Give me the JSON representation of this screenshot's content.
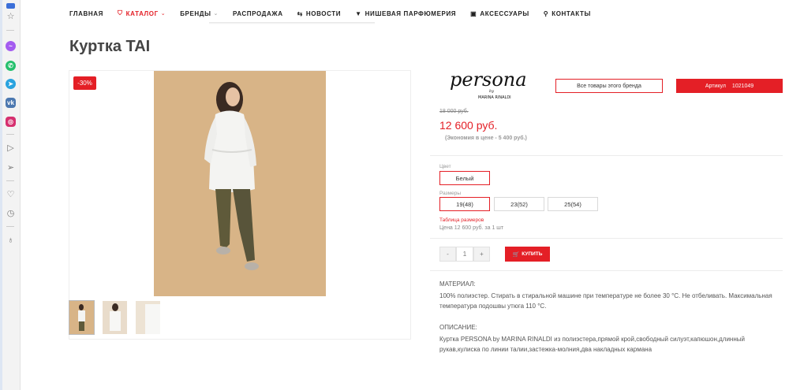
{
  "nav": {
    "items": [
      {
        "label": "ГЛАВНАЯ",
        "icon": "",
        "caret": false
      },
      {
        "label": "КАТАЛОГ",
        "icon": "bag-icon",
        "caret": true
      },
      {
        "label": "БРЕНДЫ",
        "icon": "",
        "caret": true
      },
      {
        "label": "РАСПРОДАЖА",
        "icon": "",
        "caret": false
      },
      {
        "label": "НОВОСТИ",
        "icon": "megaphone-icon",
        "caret": false
      },
      {
        "label": "НИШЕВАЯ ПАРФЮМЕРИЯ",
        "icon": "filter-icon",
        "caret": false
      },
      {
        "label": "АКСЕССУАРЫ",
        "icon": "calendar-icon",
        "caret": false
      },
      {
        "label": "КОНТАКТЫ",
        "icon": "map-pin-icon",
        "caret": false
      }
    ],
    "active_index": 1
  },
  "sidebar_icons": [
    "messenger-icon",
    "whatsapp-icon",
    "telegram-icon",
    "vk-icon",
    "instagram-icon",
    "player-icon",
    "send-icon",
    "heart-icon",
    "clock-icon",
    "lightbulb-icon"
  ],
  "product": {
    "title": "Куртка TAI",
    "discount_badge": "-30%",
    "brand_logo": {
      "name": "persona",
      "by": "by",
      "sub": "MARINA RINALDI"
    },
    "all_brand_button": "Все товары этого бренда",
    "sku_label": "Артикул",
    "sku_value": "1021049",
    "old_price": "18 000 руб.",
    "price": "12 600 руб.",
    "saving": "(Экономия в цене - 5 400 руб.)",
    "color_label": "Цвет",
    "color_value": "Белый",
    "sizes_label": "Размеры",
    "sizes": [
      "19(48)",
      "23(52)",
      "25(54)"
    ],
    "selected_size": 0,
    "size_table_link": "Таблица размеров",
    "unit_price": "Цена 12 600 руб. за 1 шт",
    "qty_minus": "-",
    "qty_value": "1",
    "qty_plus": "+",
    "buy_label": "КУПИТЬ",
    "material_heading": "МАТЕРИАЛ:",
    "material_text": "100% полиэстер. Стирать в стиральной машине при температуре не более 30 °С. Не отбеливать. Максимальная температура подошвы утюга 110 °С.",
    "description_heading": "ОПИСАНИЕ:",
    "description_text": "Куртка PERSONA by MARINA RINALDI из полиэстера,прямой крой,свободный силуэт,капюшон,длинный рукав,кулиска по линии талии,застежка-молния,два накладных кармана"
  },
  "colors": {
    "accent": "#e41f26",
    "photo_bg": "#d8b487",
    "jacket": "#f4f4f2",
    "pants": "#5f5a3a"
  }
}
